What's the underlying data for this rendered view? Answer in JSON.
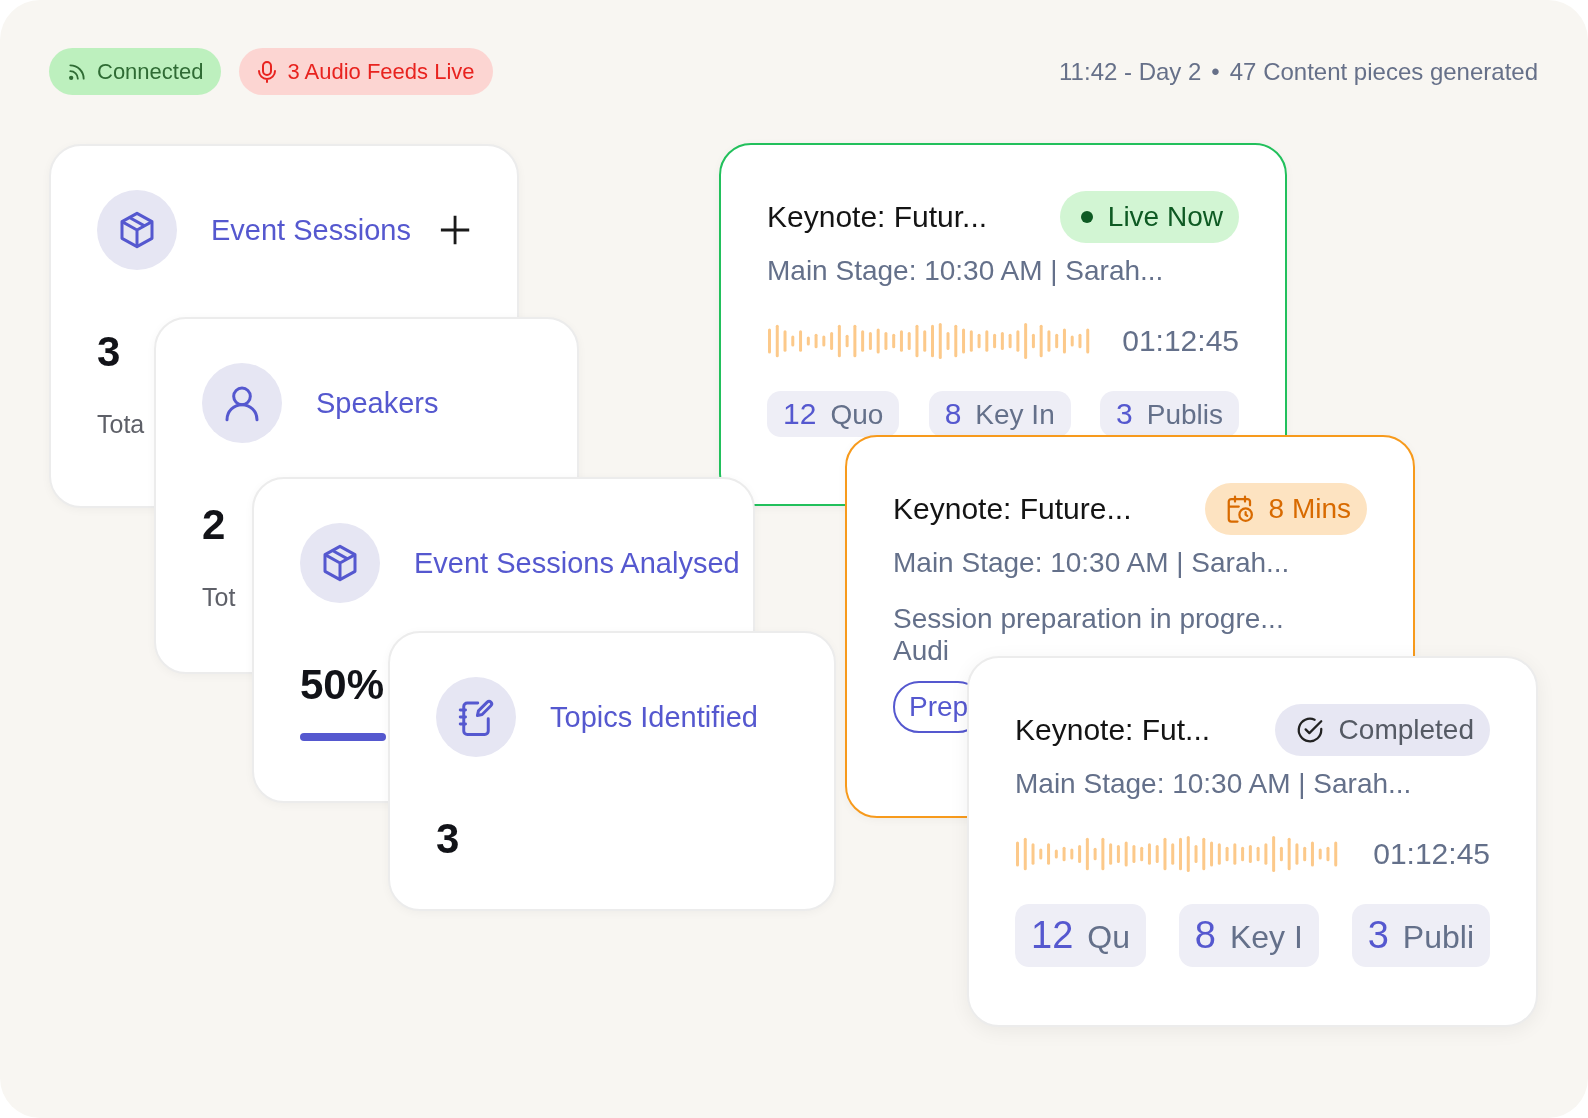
{
  "status_badges": [
    {
      "kind": "connected",
      "label": "Connected"
    },
    {
      "kind": "audio",
      "label": "3 Audio Feeds Live"
    }
  ],
  "summary": {
    "time": "11:42 - Day 2",
    "separator": "•",
    "content": "47 Content pieces generated"
  },
  "stat_cards": [
    {
      "kind": "count",
      "title": "Event Sessions",
      "addable": true,
      "value": "3",
      "caption": "Tota"
    },
    {
      "kind": "count",
      "title": "Speakers",
      "addable": false,
      "value": "2",
      "caption": "Tot"
    },
    {
      "kind": "progress",
      "title": "Event Sessions Analysed",
      "addable": false,
      "value": "50%"
    },
    {
      "kind": "count",
      "title": "Topics Identified",
      "addable": false,
      "value": "3"
    }
  ],
  "session_cards": [
    {
      "kind": "live",
      "title": "Keynote: Futur...",
      "badge": "Live Now",
      "subtitle": "Main Stage: 10:30 AM | Sarah...",
      "duration": "01:12:45",
      "chips": [
        {
          "count": "12",
          "label": "Quo"
        },
        {
          "count": "8",
          "label": "Key In"
        },
        {
          "count": "3",
          "label": "Publis"
        }
      ]
    },
    {
      "kind": "upcoming",
      "title": "Keynote: Future...",
      "badge": "8 Mins",
      "subtitle": "Main Stage: 10:30 AM | Sarah...",
      "note": "Session preparation in progre...",
      "note_2": "Audi",
      "tag": "Prep"
    },
    {
      "kind": "completed",
      "title": "Keynote: Fut...",
      "badge": "Completed",
      "subtitle": "Main Stage: 10:30 AM | Sarah...",
      "duration": "01:12:45",
      "chips": [
        {
          "count": "12",
          "label": "Qu"
        },
        {
          "count": "8",
          "label": "Key I"
        },
        {
          "count": "3",
          "label": "Publi"
        }
      ]
    }
  ]
}
